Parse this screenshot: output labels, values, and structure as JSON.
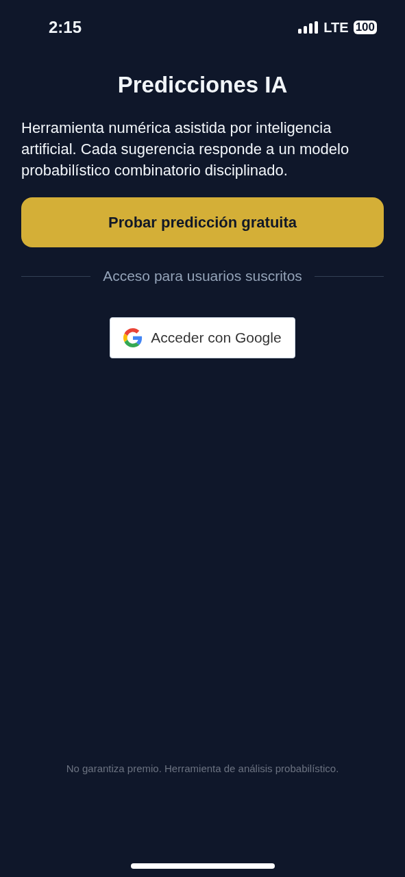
{
  "status_bar": {
    "time": "2:15",
    "network": "LTE",
    "battery": "100"
  },
  "title": "Predicciones IA",
  "description": "Herramienta numérica asistida por inteligencia artificial. Cada sugerencia responde a un modelo probabilístico combinatorio disciplinado.",
  "primary_button": "Probar predicción gratuita",
  "divider_label": "Acceso para usuarios suscritos",
  "google_button": "Acceder con Google",
  "disclaimer": "No garantiza premio. Herramienta de análisis probabilístico."
}
